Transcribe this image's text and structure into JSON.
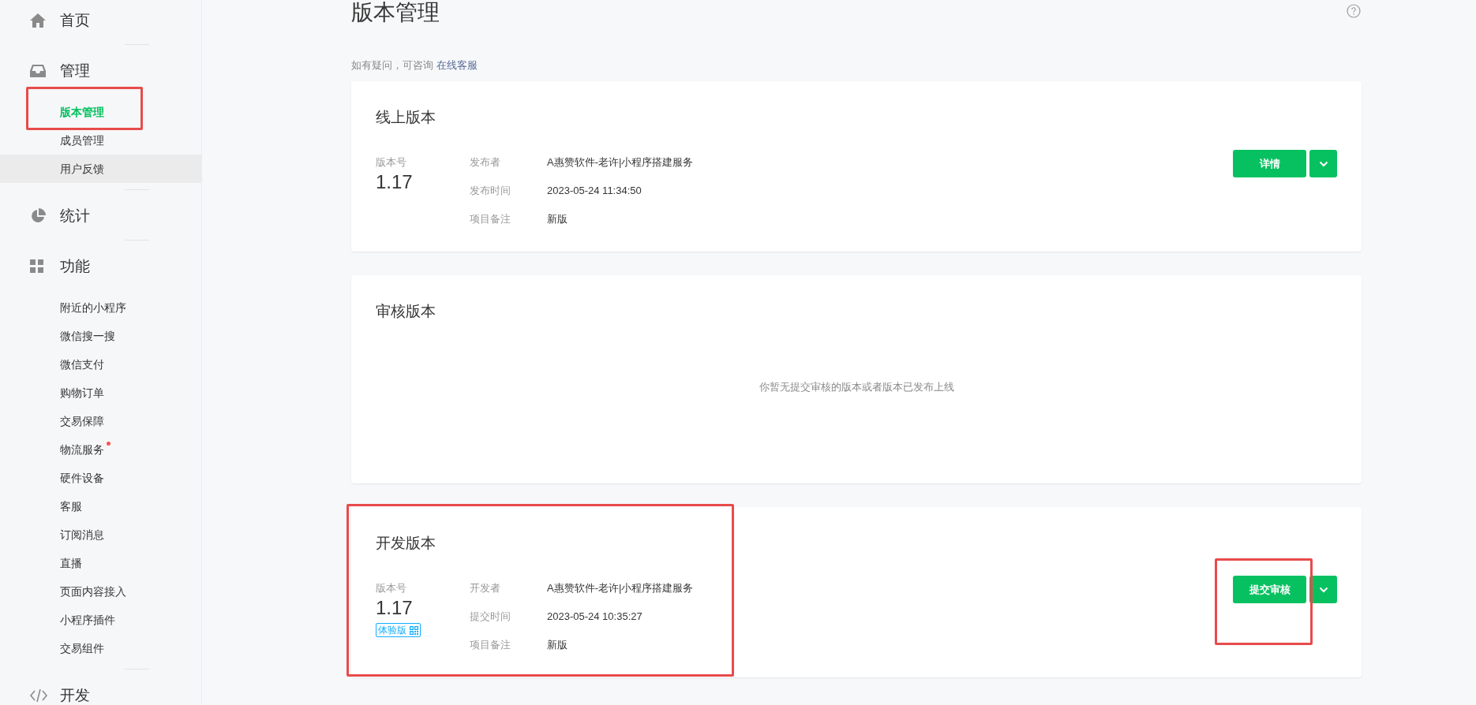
{
  "sidebar": {
    "groups": [
      {
        "kind": "home",
        "label": "首页"
      },
      {
        "kind": "manage",
        "label": "管理",
        "items": [
          {
            "label": "版本管理",
            "selected": true,
            "highlighted": false,
            "dot": false,
            "annotated": true
          },
          {
            "label": "成员管理",
            "selected": false,
            "highlighted": false,
            "dot": false,
            "annotated": false
          },
          {
            "label": "用户反馈",
            "selected": false,
            "highlighted": true,
            "dot": false,
            "annotated": false
          }
        ]
      },
      {
        "kind": "stats",
        "label": "统计"
      },
      {
        "kind": "features",
        "label": "功能",
        "items": [
          {
            "label": "附近的小程序",
            "selected": false,
            "highlighted": false,
            "dot": false,
            "annotated": false
          },
          {
            "label": "微信搜一搜",
            "selected": false,
            "highlighted": false,
            "dot": false,
            "annotated": false
          },
          {
            "label": "微信支付",
            "selected": false,
            "highlighted": false,
            "dot": false,
            "annotated": false
          },
          {
            "label": "购物订单",
            "selected": false,
            "highlighted": false,
            "dot": false,
            "annotated": false
          },
          {
            "label": "交易保障",
            "selected": false,
            "highlighted": false,
            "dot": false,
            "annotated": false
          },
          {
            "label": "物流服务",
            "selected": false,
            "highlighted": false,
            "dot": true,
            "annotated": false
          },
          {
            "label": "硬件设备",
            "selected": false,
            "highlighted": false,
            "dot": false,
            "annotated": false
          },
          {
            "label": "客服",
            "selected": false,
            "highlighted": false,
            "dot": false,
            "annotated": false
          },
          {
            "label": "订阅消息",
            "selected": false,
            "highlighted": false,
            "dot": false,
            "annotated": false
          },
          {
            "label": "直播",
            "selected": false,
            "highlighted": false,
            "dot": false,
            "annotated": false
          },
          {
            "label": "页面内容接入",
            "selected": false,
            "highlighted": false,
            "dot": false,
            "annotated": false
          },
          {
            "label": "小程序插件",
            "selected": false,
            "highlighted": false,
            "dot": false,
            "annotated": false
          },
          {
            "label": "交易组件",
            "selected": false,
            "highlighted": false,
            "dot": false,
            "annotated": false
          }
        ]
      },
      {
        "kind": "dev",
        "label": "开发"
      }
    ]
  },
  "page": {
    "title": "版本管理",
    "hint": "如有疑问，可咨询",
    "hint_link": "在线客服"
  },
  "cards": [
    {
      "kind": "version",
      "title": "线上版本",
      "annotated": false,
      "version_label": "版本号",
      "version": "1.17",
      "rows": [
        {
          "label": "发布者",
          "value": "A惠赞软件-老许|小程序搭建服务"
        },
        {
          "label": "发布时间",
          "value": "2023-05-24 11:34:50"
        },
        {
          "label": "项目备注",
          "value": "新版"
        }
      ],
      "button": {
        "label": "详情",
        "annotated": false
      }
    },
    {
      "kind": "empty",
      "title": "审核版本",
      "annotated": false,
      "message": "你暂无提交审核的版本或者版本已发布上线"
    },
    {
      "kind": "version",
      "title": "开发版本",
      "annotated": true,
      "version_label": "版本号",
      "version": "1.17",
      "badge": "体验版",
      "rows": [
        {
          "label": "开发者",
          "value": "A惠赞软件-老许|小程序搭建服务"
        },
        {
          "label": "提交时间",
          "value": "2023-05-24 10:35:27"
        },
        {
          "label": "项目备注",
          "value": "新版"
        }
      ],
      "button": {
        "label": "提交审核",
        "annotated": true
      }
    }
  ]
}
